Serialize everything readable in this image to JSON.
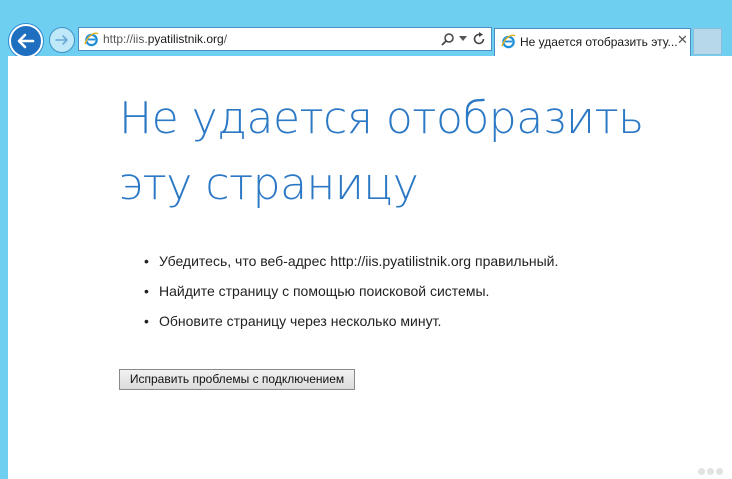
{
  "browser": {
    "address": {
      "url_prefix": "http://iis.",
      "url_host": "pyatilistnik.org",
      "url_suffix": "/"
    },
    "tab": {
      "title": "Не удается отобразить эту...",
      "close_glyph": "✕"
    }
  },
  "page": {
    "heading": "Не удается отобразить эту страницу",
    "tips": [
      "Убедитесь, что веб-адрес http://iis.pyatilistnik.org правильный.",
      "Найдите страницу с помощью поисковой системы.",
      "Обновите страницу через несколько минут."
    ],
    "fix_button_label": "Исправить проблемы с подключением"
  },
  "icons": {
    "back": "arrow-left-icon",
    "forward": "arrow-right-icon",
    "ie": "internet-explorer-icon",
    "search": "search-icon",
    "dropdown": "chevron-down-icon",
    "refresh": "refresh-icon",
    "close": "close-icon"
  },
  "colors": {
    "frame": "#6fcff0",
    "heading": "#2b78c5",
    "back_button": "#1e6fc0"
  }
}
